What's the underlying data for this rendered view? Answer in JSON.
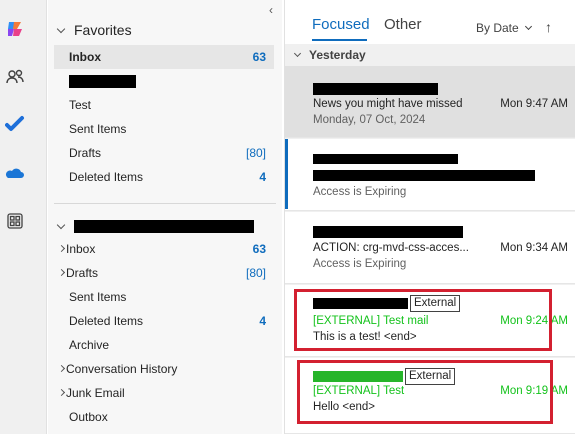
{
  "rail": {
    "icons": [
      "copilot-icon",
      "people-icon",
      "todo-icon",
      "onedrive-icon",
      "apps-icon"
    ]
  },
  "favorites": {
    "header": "Favorites",
    "items": [
      {
        "label": "Inbox",
        "count": "63",
        "selected": true
      },
      {
        "label": "",
        "redacted": true
      },
      {
        "label": "Test"
      },
      {
        "label": "Sent Items"
      },
      {
        "label": "Drafts",
        "count": "[80]"
      },
      {
        "label": "Deleted Items",
        "count": "4"
      }
    ]
  },
  "account": {
    "items": [
      {
        "label": "Inbox",
        "count": "63",
        "chevron": true
      },
      {
        "label": "Drafts",
        "count": "[80]",
        "chevron": true
      },
      {
        "label": "Sent Items"
      },
      {
        "label": "Deleted Items",
        "count": "4"
      },
      {
        "label": "Archive"
      },
      {
        "label": "Conversation History",
        "chevron": true
      },
      {
        "label": "Junk Email",
        "chevron": true
      },
      {
        "label": "Outbox"
      }
    ]
  },
  "list": {
    "tabs": {
      "focused": "Focused",
      "other": "Other"
    },
    "sort_label": "By Date",
    "section": "Yesterday",
    "messages": [
      {
        "subject": "News you might have missed",
        "time": "Mon 9:47 AM",
        "preview": "Monday, 07 Oct, 2024"
      },
      {
        "subject": "",
        "time": "",
        "preview": "Access is Expiring"
      },
      {
        "subject": "ACTION: crg-mvd-css-acces...",
        "time": "Mon 9:34 AM",
        "preview": "Access is Expiring"
      },
      {
        "tag": "External",
        "subject": "[EXTERNAL] Test mail",
        "time": "Mon 9:24 AM",
        "preview": "This is a test! <end>"
      },
      {
        "tag": "External",
        "subject": "[EXTERNAL] Test",
        "time": "Mon 9:19 AM",
        "preview": "Hello <end>"
      }
    ]
  },
  "colors": {
    "accent": "#0f6cbd",
    "external_green": "#13c21b",
    "highlight_red": "#d32030"
  }
}
